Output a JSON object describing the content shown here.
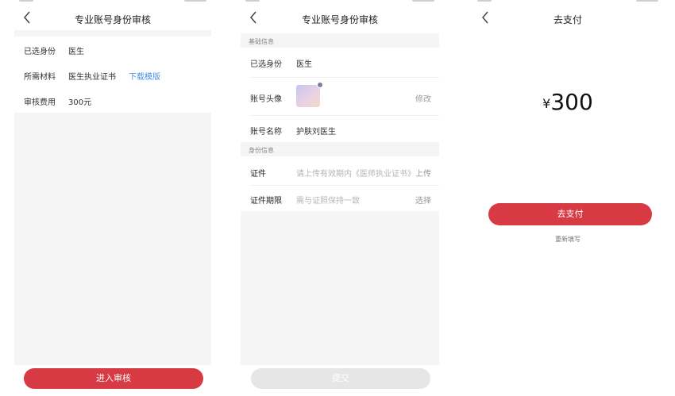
{
  "colors": {
    "accent": "#d83a44",
    "link": "#4a90e2",
    "background_grey": "#f5f5f5",
    "disabled": "#e6e6e6"
  },
  "icons": {
    "back": "chevron-left-icon",
    "edit_dot": "edit-icon"
  },
  "screen1": {
    "title": "专业账号身份审核",
    "rows": [
      {
        "label": "已选身份",
        "value": "医生"
      },
      {
        "label": "所需材料",
        "value": "医生执业证书",
        "link": "下载模版"
      },
      {
        "label": "审核费用",
        "value": "300元"
      }
    ],
    "submit_label": "进入审核"
  },
  "screen2": {
    "title": "专业账号身份审核",
    "section_basic": "基础信息",
    "identity_label": "已选身份",
    "identity_value": "医生",
    "avatar_label": "账号头像",
    "avatar_action": "修改",
    "name_label": "账号名称",
    "name_value": "护肤刘医生",
    "section_identity": "身份信息",
    "cert_label": "证件",
    "cert_placeholder": "请上传有效期内《医师执业证书》",
    "cert_action": "上传",
    "period_label": "证件期限",
    "period_placeholder": "需与证照保持一致",
    "period_action": "选择",
    "submit_label": "提交"
  },
  "screen3": {
    "title": "去支付",
    "currency": "¥",
    "amount": "300",
    "pay_label": "去支付",
    "refill_label": "重新填写"
  }
}
